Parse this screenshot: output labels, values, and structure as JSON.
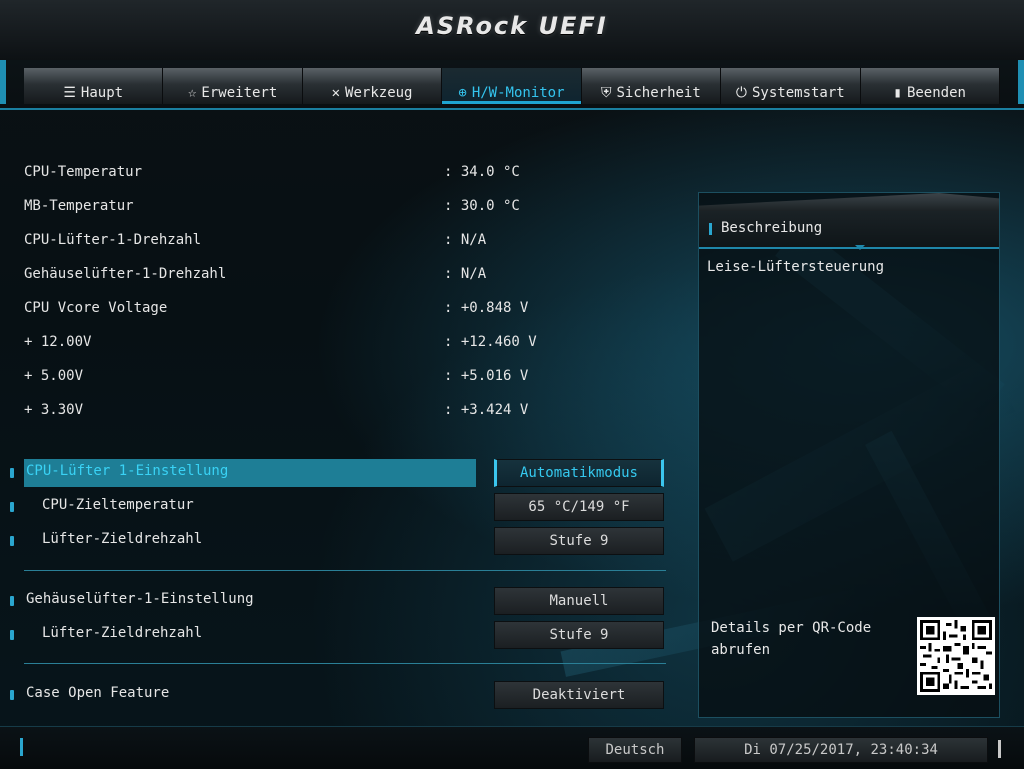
{
  "app": {
    "title": "ASRock UEFI"
  },
  "tabs": [
    {
      "label": "Haupt",
      "icon": "list-icon",
      "glyph": "☰",
      "active": false
    },
    {
      "label": "Erweitert",
      "icon": "star-icon",
      "glyph": "☆",
      "active": false
    },
    {
      "label": "Werkzeug",
      "icon": "tools-icon",
      "glyph": "✕",
      "active": false
    },
    {
      "label": "H/W-Monitor",
      "icon": "monitor-icon",
      "glyph": "⊕",
      "active": true
    },
    {
      "label": "Sicherheit",
      "icon": "shield-icon",
      "glyph": "⛨",
      "active": false
    },
    {
      "label": "Systemstart",
      "icon": "power-icon",
      "glyph": "⏻",
      "active": false
    },
    {
      "label": "Beenden",
      "icon": "exit-icon",
      "glyph": "▮",
      "active": false
    }
  ],
  "readings": [
    {
      "label": "CPU-Temperatur",
      "value": ": 34.0 °C"
    },
    {
      "label": "MB-Temperatur",
      "value": ": 30.0 °C"
    },
    {
      "label": "CPU-Lüfter-1-Drehzahl",
      "value": ": N/A"
    },
    {
      "label": "Gehäuselüfter-1-Drehzahl",
      "value": ": N/A"
    },
    {
      "label": "CPU Vcore Voltage",
      "value": ": +0.848 V"
    },
    {
      "label": "+ 12.00V",
      "value": ": +12.460 V"
    },
    {
      "label": "+ 5.00V",
      "value": ": +5.016 V"
    },
    {
      "label": "+ 3.30V",
      "value": ": +3.424 V"
    }
  ],
  "settings": [
    {
      "label": "CPU-Lüfter 1-Einstellung",
      "value": "Automatikmodus",
      "selected": true,
      "indent": false
    },
    {
      "label": "CPU-Zieltemperatur",
      "value": "65 °C/149 °F",
      "selected": false,
      "indent": true
    },
    {
      "label": "Lüfter-Zieldrehzahl",
      "value": "Stufe 9",
      "selected": false,
      "indent": true
    },
    {
      "label": "Gehäuselüfter-1-Einstellung",
      "value": "Manuell",
      "selected": false,
      "indent": false
    },
    {
      "label": "Lüfter-Zieldrehzahl",
      "value": "Stufe 9",
      "selected": false,
      "indent": true
    },
    {
      "label": "Case Open Feature",
      "value": "Deaktiviert",
      "selected": false,
      "indent": false
    }
  ],
  "description": {
    "heading": "Beschreibung",
    "text": "Leise-Lüftersteuerung",
    "qr_label": "Details per QR-Code abrufen"
  },
  "footer": {
    "language": "Deutsch",
    "datetime": "Di 07/25/2017, 23:40:34"
  },
  "colors": {
    "accent": "#1fa5d2",
    "highlight": "#1e7e96",
    "active_text": "#35c9ef"
  }
}
